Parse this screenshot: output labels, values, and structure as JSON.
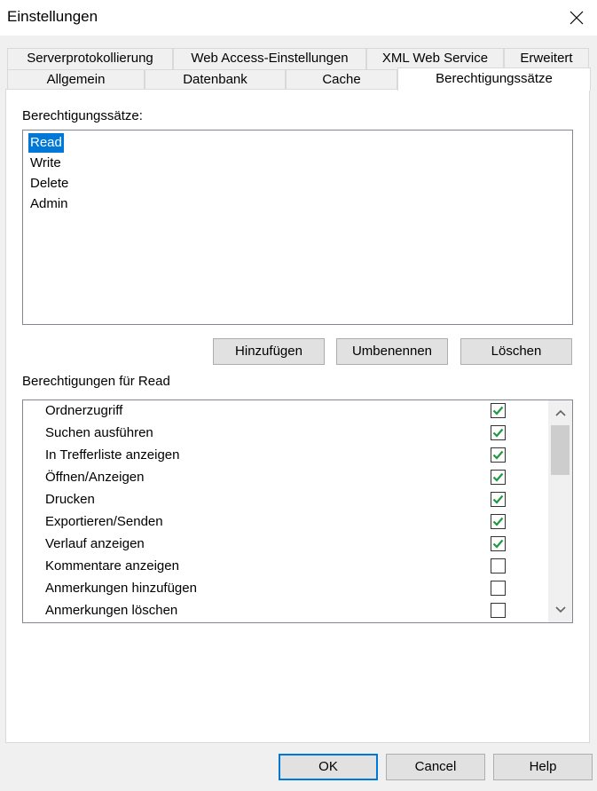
{
  "window": {
    "title": "Einstellungen"
  },
  "tabs_row1": [
    "Serverprotokollierung",
    "Web Access-Einstellungen",
    "XML Web Service",
    "Erweitert"
  ],
  "tabs_row2": [
    "Allgemein",
    "Datenbank",
    "Cache",
    "Berechtigungssätze"
  ],
  "active_tab": "Berechtigungssätze",
  "permission_sets": {
    "label": "Berechtigungssätze:",
    "items": [
      "Read",
      "Write",
      "Delete",
      "Admin"
    ],
    "selected": "Read",
    "buttons": {
      "add": "Hinzufügen",
      "rename": "Umbenennen",
      "delete": "Löschen"
    }
  },
  "permissions": {
    "label": "Berechtigungen für Read",
    "items": [
      {
        "label": "Ordnerzugriff",
        "checked": true
      },
      {
        "label": "Suchen ausführen",
        "checked": true
      },
      {
        "label": "In Trefferliste anzeigen",
        "checked": true
      },
      {
        "label": "Öffnen/Anzeigen",
        "checked": true
      },
      {
        "label": "Drucken",
        "checked": true
      },
      {
        "label": "Exportieren/Senden",
        "checked": true
      },
      {
        "label": "Verlauf anzeigen",
        "checked": true
      },
      {
        "label": "Kommentare anzeigen",
        "checked": false
      },
      {
        "label": "Anmerkungen hinzufügen",
        "checked": false
      },
      {
        "label": "Anmerkungen löschen",
        "checked": false
      }
    ]
  },
  "footer": {
    "ok": "OK",
    "cancel": "Cancel",
    "help": "Help"
  },
  "colors": {
    "selection": "#0078d7",
    "check": "#1f9a3f"
  }
}
